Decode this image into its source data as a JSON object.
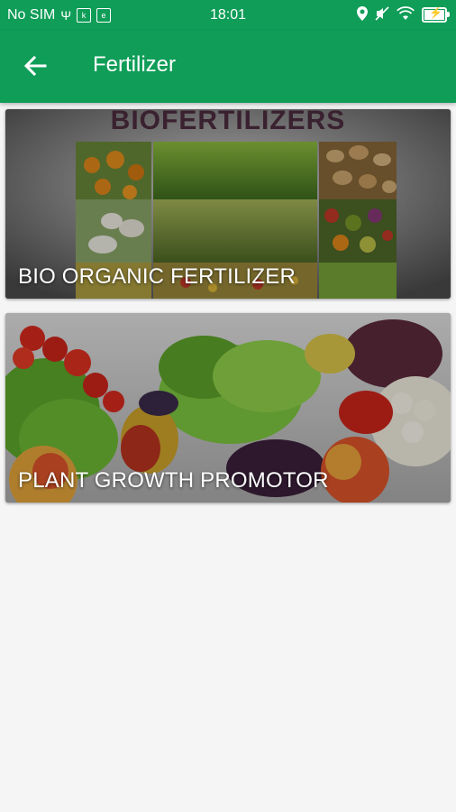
{
  "status_bar": {
    "carrier": "No SIM",
    "time": "18:01"
  },
  "app_bar": {
    "title": "Fertilizer",
    "back_icon": "arrow-left-icon"
  },
  "cards": [
    {
      "banner_text": "BIOFERTILIZERS",
      "label": "BIO ORGANIC FERTILIZER"
    },
    {
      "label": "PLANT GROWTH PROMOTOR"
    }
  ],
  "colors": {
    "primary": "#0f9d58",
    "background": "#f5f5f5"
  }
}
